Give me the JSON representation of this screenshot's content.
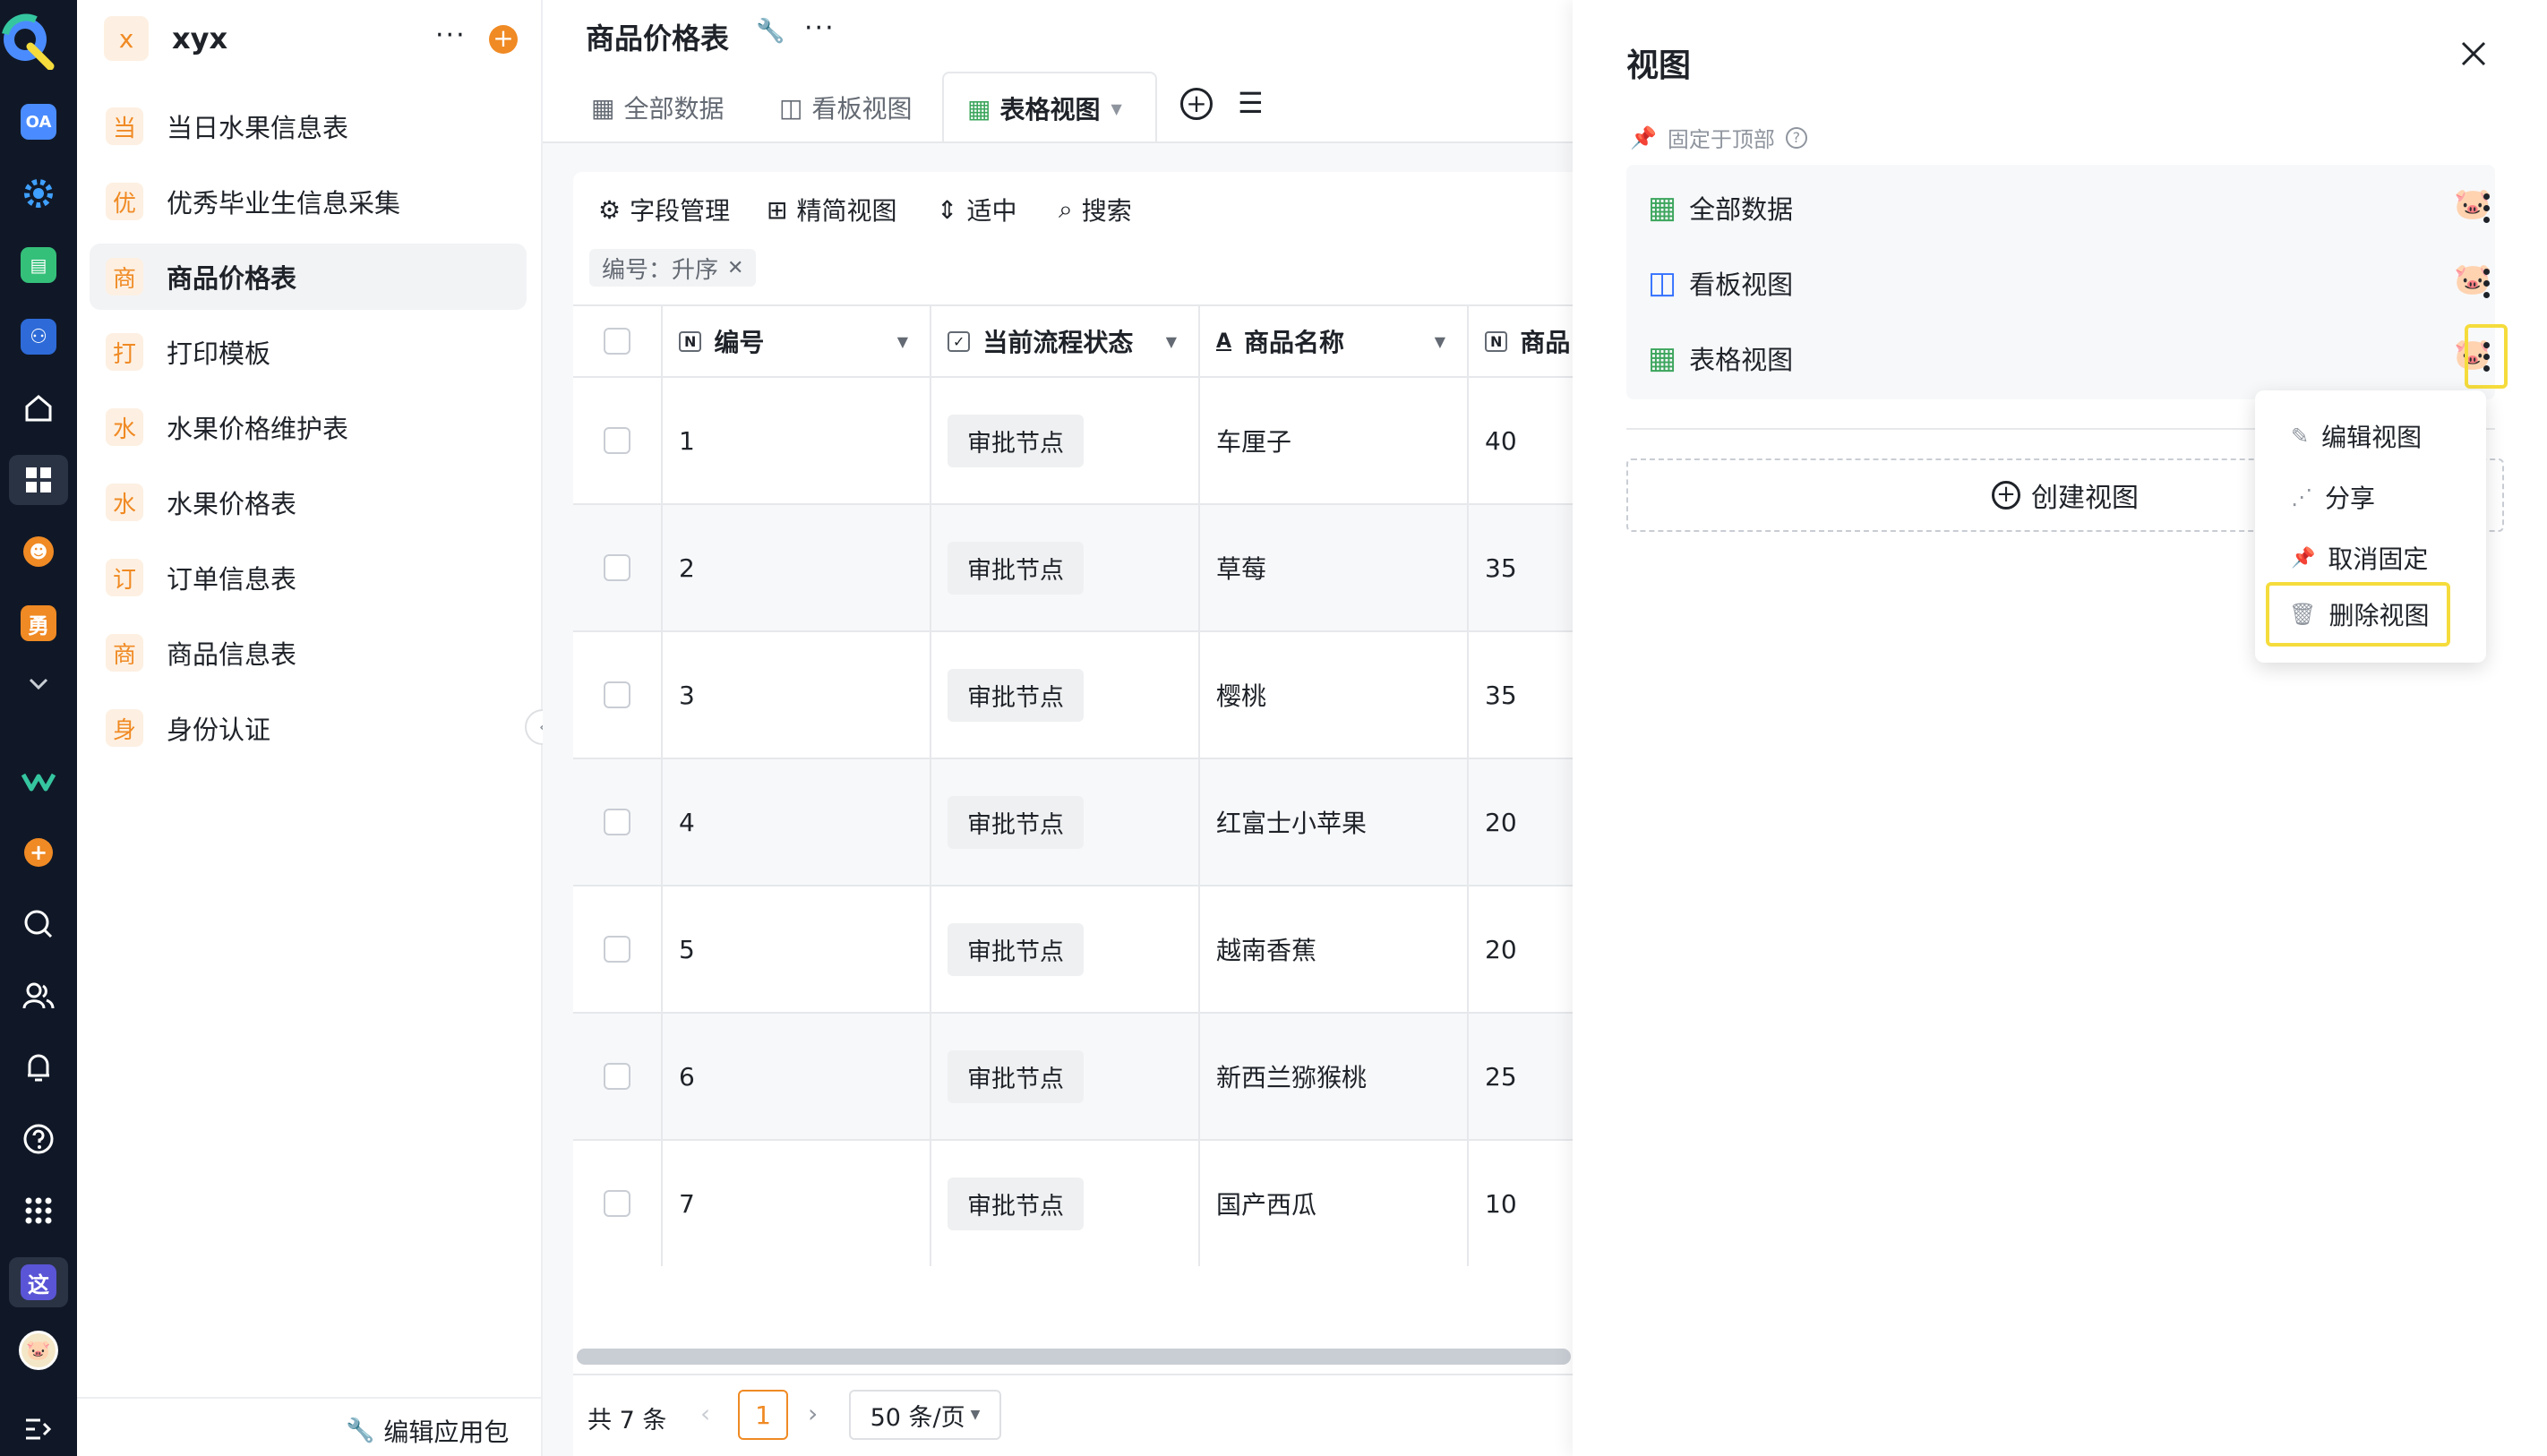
{
  "colors": {
    "rail_bg": "#101827",
    "accent_orange": "#f08a24",
    "green": "#3ba55c",
    "blue": "#3370ff",
    "highlight": "#f5dc3c"
  },
  "app": {
    "badge": "x",
    "name": "xyx",
    "edit_package": "编辑应用包"
  },
  "sidebar": {
    "items": [
      {
        "badge": "当",
        "label": "当日水果信息表"
      },
      {
        "badge": "优",
        "label": "优秀毕业生信息采集"
      },
      {
        "badge": "商",
        "label": "商品价格表"
      },
      {
        "badge": "打",
        "label": "打印模板"
      },
      {
        "badge": "水",
        "label": "水果价格维护表"
      },
      {
        "badge": "水",
        "label": "水果价格表"
      },
      {
        "badge": "订",
        "label": "订单信息表"
      },
      {
        "badge": "商",
        "label": "商品信息表"
      },
      {
        "badge": "身",
        "label": "身份认证"
      }
    ]
  },
  "rail": {
    "oa": "OA",
    "yong": "勇",
    "zhe": "这"
  },
  "main": {
    "title": "商品价格表",
    "tabs": [
      {
        "label": "全部数据"
      },
      {
        "label": "看板视图"
      },
      {
        "label": "表格视图"
      }
    ],
    "toolbar": {
      "fields": "字段管理",
      "compact": "精简视图",
      "fit": "适中",
      "search": "搜索"
    },
    "sort_chip": "编号：升序",
    "columns": [
      {
        "icon": "N",
        "label": "编号"
      },
      {
        "icon": "✓",
        "label": "当前流程状态"
      },
      {
        "icon": "A",
        "label": "商品名称"
      },
      {
        "icon": "N",
        "label": "商品"
      }
    ],
    "rows": [
      {
        "id": "1",
        "status": "审批节点",
        "name": "车厘子",
        "price": "40"
      },
      {
        "id": "2",
        "status": "审批节点",
        "name": "草莓",
        "price": "35"
      },
      {
        "id": "3",
        "status": "审批节点",
        "name": "樱桃",
        "price": "35"
      },
      {
        "id": "4",
        "status": "审批节点",
        "name": "红富士小苹果",
        "price": "20"
      },
      {
        "id": "5",
        "status": "审批节点",
        "name": "越南香蕉",
        "price": "20"
      },
      {
        "id": "6",
        "status": "审批节点",
        "name": "新西兰猕猴桃",
        "price": "25"
      },
      {
        "id": "7",
        "status": "审批节点",
        "name": "国产西瓜",
        "price": "10"
      }
    ],
    "pagination": {
      "total": "共 7 条",
      "page": "1",
      "page_size": "50 条/页"
    }
  },
  "panel": {
    "title": "视图",
    "pin_label": "固定于顶部",
    "views": [
      {
        "label": "全部数据"
      },
      {
        "label": "看板视图"
      },
      {
        "label": "表格视图"
      }
    ],
    "create": "创建视图",
    "menu": {
      "edit": "编辑视图",
      "share": "分享",
      "unpin": "取消固定",
      "delete": "删除视图"
    }
  }
}
